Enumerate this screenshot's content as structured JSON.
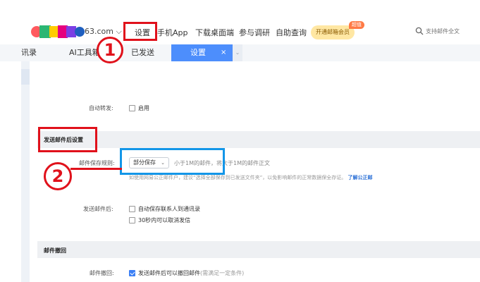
{
  "header": {
    "logo_text": "63.com ⌵",
    "nav": [
      {
        "label": "设置"
      },
      {
        "label": "手机App"
      },
      {
        "label": "下载桌面端"
      },
      {
        "label": "参与调研"
      },
      {
        "label": "自助查询"
      }
    ],
    "vip_badge": "开通邮箱会员",
    "vip_tag": "超值",
    "search_placeholder": "支持邮件全文"
  },
  "tabs": [
    {
      "label": "讯录"
    },
    {
      "label": "AI工具箱"
    },
    {
      "label": "已发送"
    },
    {
      "label": "设置",
      "active": true
    }
  ],
  "tab_close": "×",
  "tab_more": "⌄",
  "settings": {
    "auto_forward": {
      "label": "自动转发:",
      "option": "启用",
      "checked": false
    },
    "after_send_section": "发送邮件后设置",
    "save_rule": {
      "label": "邮件保存规则:",
      "selected": "部分保存",
      "note": "小于1M的邮件，将大于1M的邮件正文",
      "hint": "如使用网易公正邮件户，建议“选择全部保存到已发送文件夹”，以免影响邮件的正常数据保全存证。",
      "hint_link": "了解公正邮"
    },
    "after_send": {
      "label": "发送邮件后:",
      "options": [
        {
          "text": "自动保存联系人到通讯录",
          "checked": false
        },
        {
          "text": "30秒内可以取消发信",
          "checked": false
        }
      ]
    },
    "recall_section": "邮件撤回",
    "recall": {
      "label": "邮件撤回:",
      "option": "发送邮件后可以撤回邮件",
      "option_note": "(需满足一定条件)",
      "checked": true
    }
  },
  "annotations": {
    "step1": "1",
    "step2": "2"
  },
  "colors": {
    "annotation_red": "#e0111b",
    "annotation_blue": "#1396e8",
    "tab_active": "#4d8efc",
    "link": "#2a6fd6"
  }
}
